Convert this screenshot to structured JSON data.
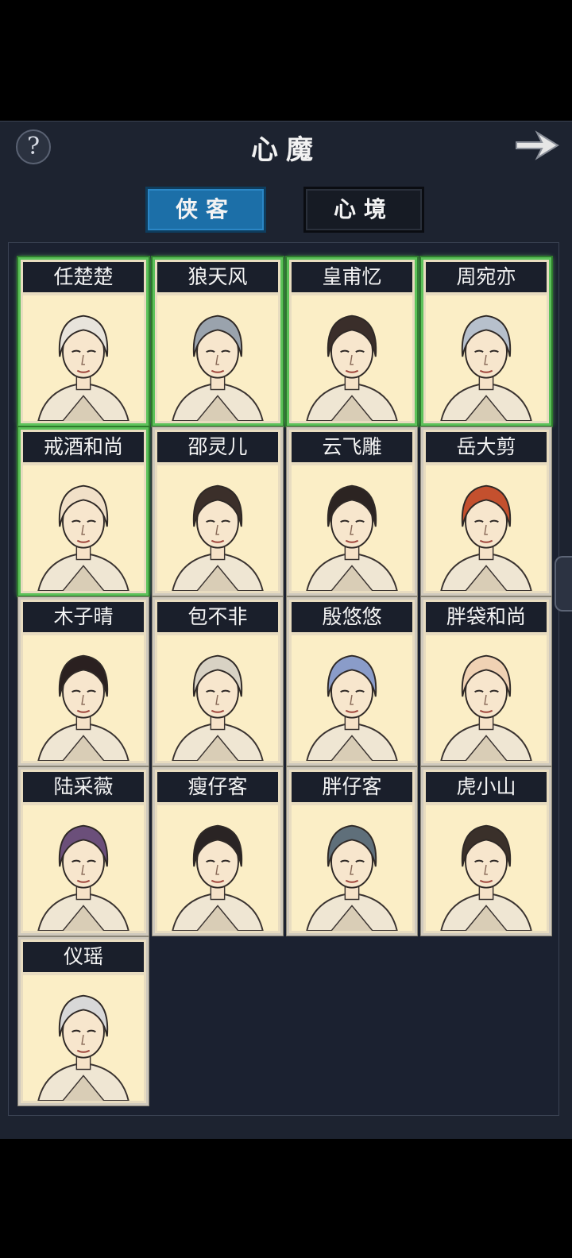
{
  "header": {
    "title": "心魔",
    "help_label": "?",
    "icons": {
      "help": "question-mark-icon",
      "next": "arrow-right-icon"
    }
  },
  "tabs": [
    {
      "label": "侠客",
      "active": true
    },
    {
      "label": "心境",
      "active": false
    }
  ],
  "colors": {
    "panel_bg": "#1d2330",
    "tab_active": "#1c6fa8",
    "owned_border": "#5cc15a",
    "card_bg": "#fbeec6"
  },
  "characters": [
    {
      "name": "任楚楚",
      "owned": true
    },
    {
      "name": "狼天风",
      "owned": true
    },
    {
      "name": "皇甫忆",
      "owned": true
    },
    {
      "name": "周宛亦",
      "owned": true
    },
    {
      "name": "戒酒和尚",
      "owned": true
    },
    {
      "name": "邵灵儿",
      "owned": false
    },
    {
      "name": "云飞雕",
      "owned": false
    },
    {
      "name": "岳大剪",
      "owned": false
    },
    {
      "name": "木子晴",
      "owned": false
    },
    {
      "name": "包不非",
      "owned": false
    },
    {
      "name": "殷悠悠",
      "owned": false
    },
    {
      "name": "胖袋和尚",
      "owned": false
    },
    {
      "name": "陆采薇",
      "owned": false
    },
    {
      "name": "瘦仔客",
      "owned": false
    },
    {
      "name": "胖仔客",
      "owned": false
    },
    {
      "name": "虎小山",
      "owned": false
    },
    {
      "name": "仪瑶",
      "owned": false
    }
  ]
}
